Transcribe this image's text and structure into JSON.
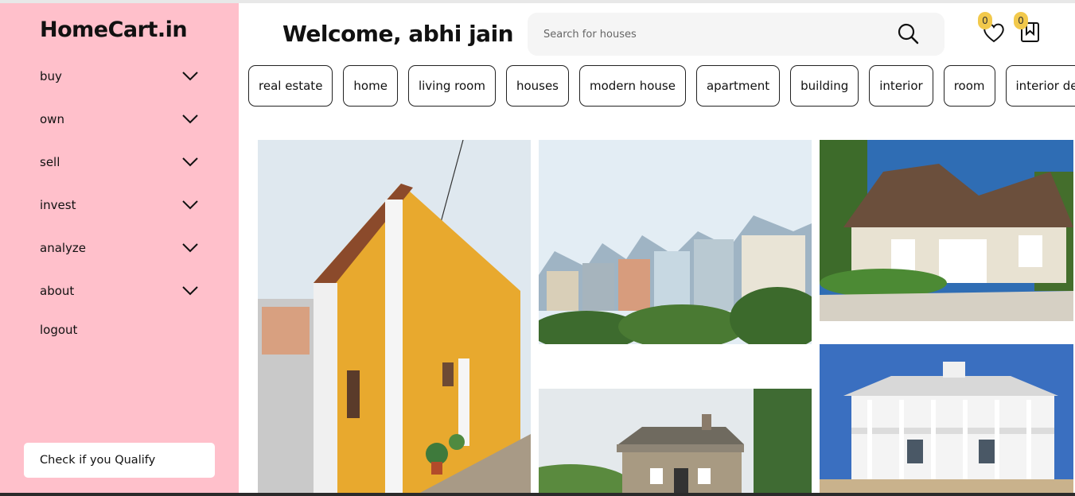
{
  "sidebar": {
    "brand": "HomeCart.in",
    "items": [
      {
        "label": "buy"
      },
      {
        "label": "own"
      },
      {
        "label": "sell"
      },
      {
        "label": "invest"
      },
      {
        "label": "analyze"
      },
      {
        "label": "about"
      }
    ],
    "logout": "logout",
    "qualify_button": "Check if you Qualify",
    "background": "#ffc0cb"
  },
  "header": {
    "welcome": "Welcome, abhi jain",
    "search_placeholder": "Search for houses",
    "wishlist_count": "0",
    "saved_count": "0",
    "icons": [
      "search-icon",
      "heart-icon",
      "bookmark-icon"
    ],
    "badge_color": "#f2c94c"
  },
  "tags": [
    "real estate",
    "home",
    "living room",
    "houses",
    "modern house",
    "apartment",
    "building",
    "interior",
    "room",
    "interior design"
  ],
  "gallery": [
    {
      "name": "photo-yellow-house"
    },
    {
      "name": "photo-victorian-row-houses"
    },
    {
      "name": "photo-brown-roof-house"
    },
    {
      "name": "photo-log-cabin"
    },
    {
      "name": "photo-white-mansion"
    }
  ]
}
